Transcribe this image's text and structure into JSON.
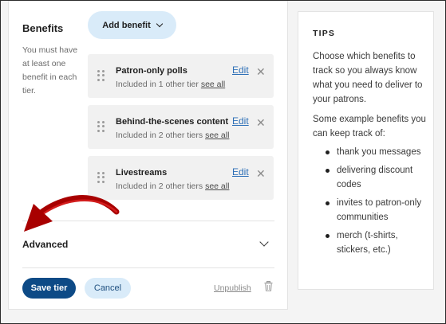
{
  "benefits": {
    "title": "Benefits",
    "help_text": "You must have at least one benefit in each tier.",
    "add_button_label": "Add benefit",
    "items": [
      {
        "name": "Patron-only polls",
        "included_text": "Included in 1 other tier",
        "see_all": "see all",
        "edit_label": "Edit"
      },
      {
        "name": "Behind-the-scenes content",
        "included_text": "Included in 2 other tiers",
        "see_all": "see all",
        "edit_label": "Edit"
      },
      {
        "name": "Livestreams",
        "included_text": "Included in 2 other tiers",
        "see_all": "see all",
        "edit_label": "Edit"
      }
    ]
  },
  "advanced": {
    "label": "Advanced"
  },
  "footer": {
    "save_label": "Save tier",
    "cancel_label": "Cancel",
    "unpublish_label": "Unpublish"
  },
  "tips": {
    "title": "TIPS",
    "paragraph1": "Choose which benefits to track so you always know what you need to deliver to your patrons.",
    "paragraph2": "Some example benefits you can keep track of:",
    "items": [
      "thank you messages",
      "delivering discount codes",
      "invites to patron-only communities",
      "merch (t-shirts, stickers, etc.)"
    ]
  },
  "colors": {
    "primary_button": "#0d4a86",
    "secondary_button": "#d9ebf9",
    "link": "#2d6fb7",
    "annotation_arrow": "#b00000"
  }
}
